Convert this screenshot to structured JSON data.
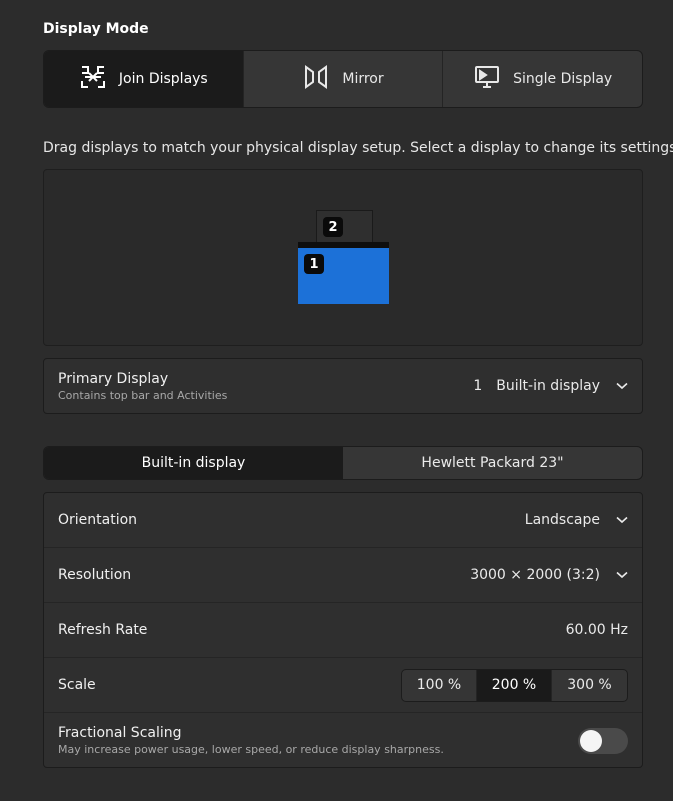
{
  "display_mode": {
    "heading": "Display Mode",
    "options": [
      {
        "label": "Join Displays",
        "icon": "join-displays-icon",
        "active": true
      },
      {
        "label": "Mirror",
        "icon": "mirror-icon",
        "active": false
      },
      {
        "label": "Single Display",
        "icon": "single-display-icon",
        "active": false
      }
    ]
  },
  "arrangement": {
    "hint": "Drag displays to match your physical display setup. Select a display to change its settings.",
    "monitors": [
      {
        "number": "1",
        "color": "#1c71d8"
      },
      {
        "number": "2",
        "color": "#2f2f2f"
      }
    ]
  },
  "primary_display": {
    "title": "Primary Display",
    "subtitle": "Contains top bar and Activities",
    "number": "1",
    "value": "Built-in display"
  },
  "display_tabs": [
    {
      "label": "Built-in display",
      "active": true
    },
    {
      "label": "Hewlett Packard 23\"",
      "active": false
    }
  ],
  "settings": {
    "orientation": {
      "label": "Orientation",
      "value": "Landscape"
    },
    "resolution": {
      "label": "Resolution",
      "value": "3000 × 2000 (3:2)"
    },
    "refresh_rate": {
      "label": "Refresh Rate",
      "value": "60.00 Hz"
    },
    "scale": {
      "label": "Scale",
      "options": [
        "100 %",
        "200 %",
        "300 %"
      ],
      "selected": "200 %"
    },
    "fractional_scaling": {
      "label": "Fractional Scaling",
      "subtitle": "May increase power usage, lower speed, or reduce display sharpness.",
      "enabled": false
    }
  },
  "colors": {
    "accent": "#1c71d8",
    "background": "#2c2c2c",
    "active_segment": "#1b1b1b"
  }
}
